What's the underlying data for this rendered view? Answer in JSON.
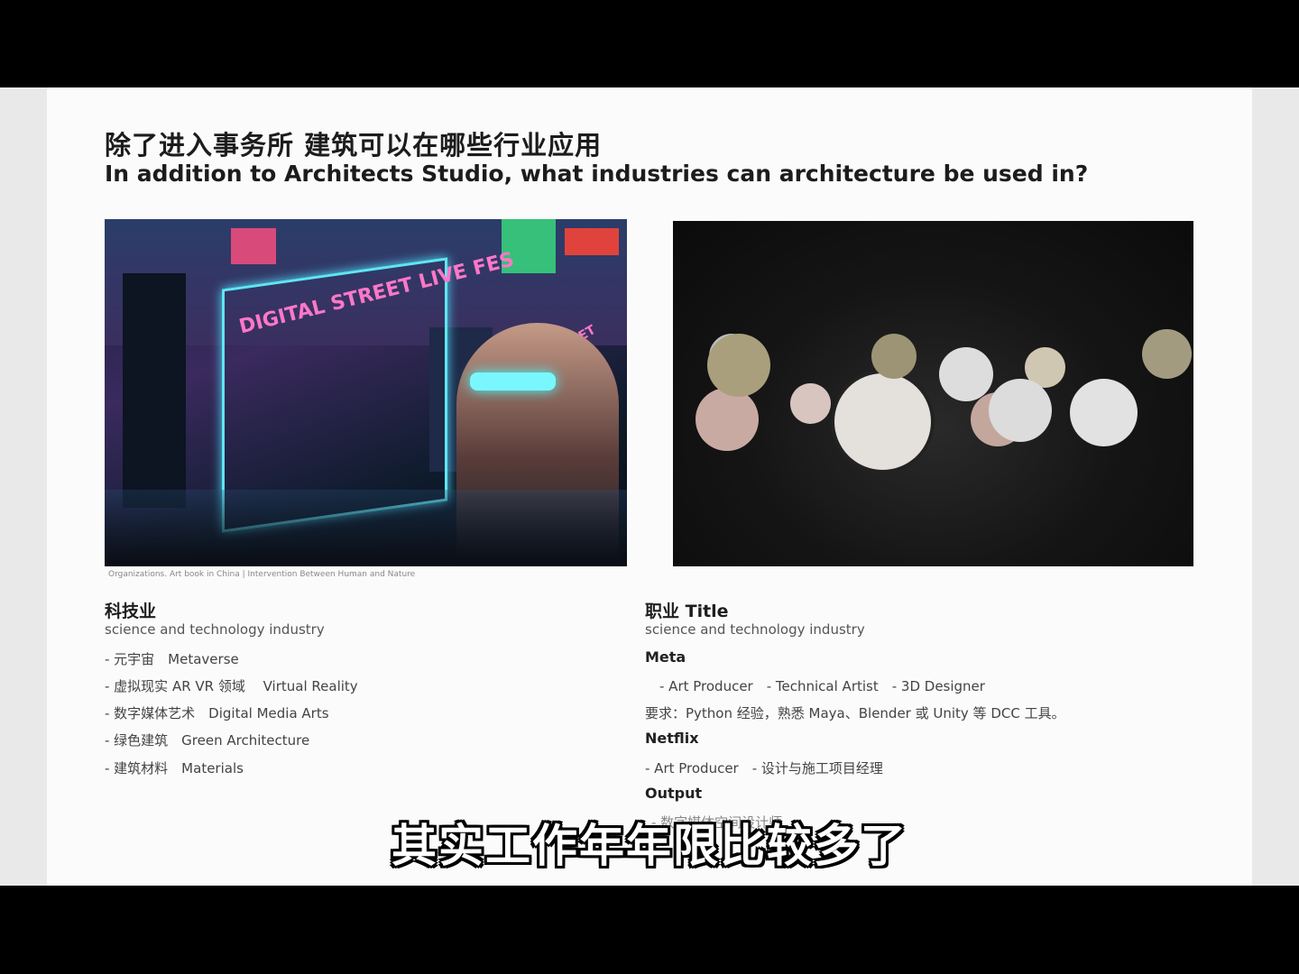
{
  "slide": {
    "title_cn": "除了进入事务所 建筑可以在哪些行业应用",
    "title_en": "In addition to Architects Studio, what industries can architecture be used in?",
    "image_left": {
      "sign_text": "DIGITAL STREET LIVE FES",
      "sign_text_2": "STREET PAST"
    },
    "caption": "Organizations. Art book in China | Intervention Between Human and Nature",
    "left": {
      "heading": "科技业",
      "subheading": "science and technology industry",
      "items": [
        "- 元宇宙　Metaverse",
        "- 虚拟现实 AR VR 领域　 Virtual Reality",
        "- 数字媒体艺术　Digital Media Arts",
        "- 绿色建筑　Green Architecture",
        "- 建筑材料　Materials"
      ]
    },
    "right": {
      "heading": "职业 Title",
      "subheading": "science and technology industry",
      "meta_label": "Meta",
      "meta_roles": "- Art Producer　- Technical Artist　- 3D Designer",
      "meta_req": "要求：Python 经验，熟悉 Maya、Blender 或 Unity 等 DCC 工具。",
      "netflix_label": "Netflix",
      "netflix_roles": "- Art Producer　- 设计与施工项目经理",
      "output_label": "Output",
      "output_roles": "- 数字媒体空间设计师"
    }
  },
  "subtitle": "其实工作年年限比较多了"
}
